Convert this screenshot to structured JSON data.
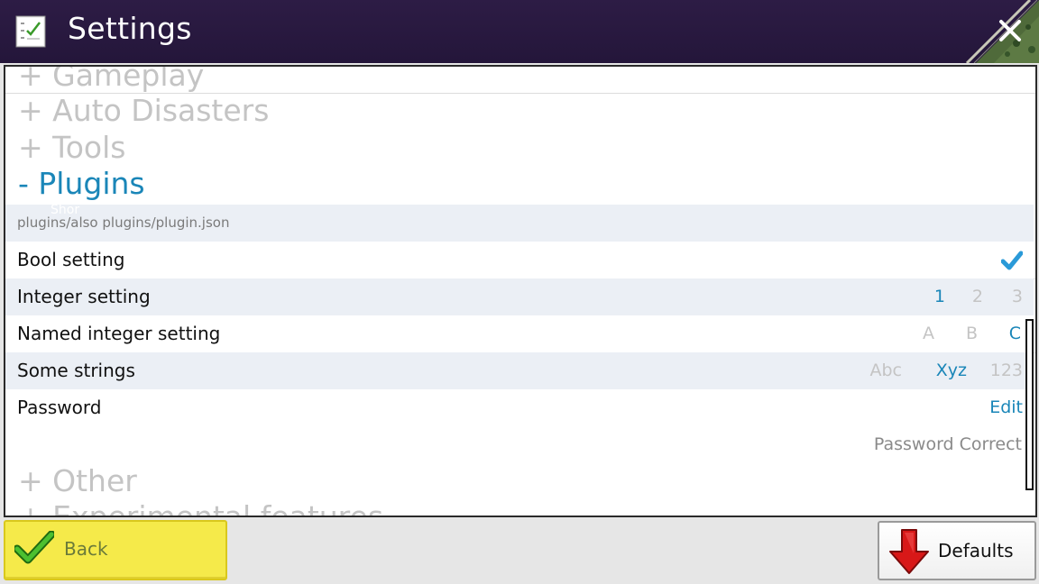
{
  "window": {
    "title": "Settings",
    "icons": {
      "app": "checklist-icon",
      "close": "close-icon"
    }
  },
  "sections": [
    {
      "label": "+ Gameplay",
      "state": "collapsed"
    },
    {
      "label": "+ Auto Disasters",
      "state": "collapsed"
    },
    {
      "label": "+ Tools",
      "state": "collapsed"
    },
    {
      "label": "- Plugins",
      "state": "expanded"
    },
    {
      "label": "+ Other",
      "state": "collapsed"
    },
    {
      "label": "+ Experimental features",
      "state": "collapsed"
    }
  ],
  "plugin": {
    "path": "plugins/also plugins/plugin.json",
    "ghost_text": "Shor"
  },
  "settings": {
    "bool": {
      "label": "Bool setting",
      "checked": true,
      "icon": "checkmark-icon"
    },
    "integer": {
      "label": "Integer setting",
      "options": [
        "1",
        "2",
        "3"
      ],
      "selected": "1"
    },
    "named_integer": {
      "label": "Named integer setting",
      "options": [
        "A",
        "B",
        "C"
      ],
      "selected": "C"
    },
    "strings": {
      "label": "Some strings",
      "options": [
        "Abc",
        "Xyz",
        "123"
      ],
      "selected": "Xyz"
    },
    "password": {
      "label": "Password",
      "action": "Edit",
      "status": "Password Correct"
    }
  },
  "buttons": {
    "back": {
      "label": "Back",
      "icon": "green-checkmark-icon"
    },
    "defaults": {
      "label": "Defaults",
      "icon": "red-down-arrow-icon"
    }
  },
  "colors": {
    "title_bar": "#2d1c45",
    "accent": "#1a86b8",
    "inactive": "#c4c4c4",
    "back_button": "#f5ea4a",
    "defaults_arrow": "#d81818"
  }
}
